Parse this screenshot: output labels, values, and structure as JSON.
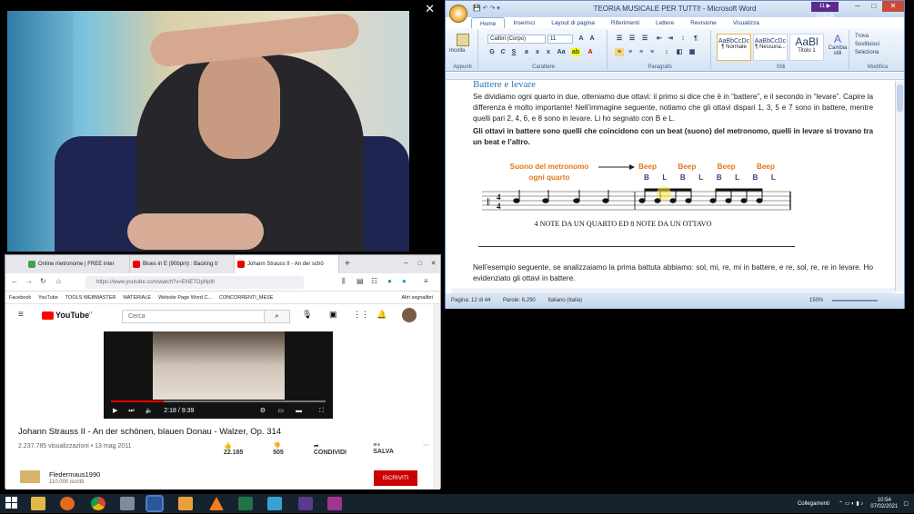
{
  "word": {
    "window_title": "TEORIA MUSICALE PER TUTTI! - Microsoft Word",
    "badge": "11 ▶ 0:03:28",
    "tabs": [
      "Home",
      "Inserisci",
      "Layout di pagina",
      "Riferimenti",
      "Lettere",
      "Revisione",
      "Visualizza"
    ],
    "font_name": "Calibri (Corpo)",
    "font_size": "11",
    "paste_label": "Incolla",
    "groups": {
      "clipboard": "Appunti",
      "font": "Carattere",
      "paragraph": "Paragrafo",
      "styles": "Stili",
      "editing": "Modifica"
    },
    "styles": [
      {
        "preview": "AaBbCcDc",
        "name": "¶ Normale"
      },
      {
        "preview": "AaBbCcDc",
        "name": "¶ Nessuna..."
      },
      {
        "preview": "AaBl",
        "name": "Titolo 1"
      }
    ],
    "change_styles": "Cambia stili",
    "editing": {
      "find": "Trova",
      "replace": "Sostituisci",
      "select": "Seleziona"
    },
    "heading": "Battere e levare",
    "para1": "Se dividiamo ogni quarto in due, otteniamo due ottavi: il primo si dice che è in “battere”, e il secondo in “levare”. Capire la differenza è molto importante! Nell’immagine seguente, notiamo che gli ottavi dispari 1, 3, 5 e 7 sono in battere, mentre quelli pari 2, 4, 6, e 8 sono in levare. Li ho segnato con B e L.",
    "para2": "Gli ottavi in battere sono quelli che coincidono con un beat (suono) del metronomo, quelli in levare si trovano tra un beat e l’altro.",
    "figure_label": "Suono del metronomo ogni quarto",
    "beeps": [
      "Beep",
      "Beep",
      "Beep",
      "Beep"
    ],
    "bl": [
      "B",
      "L",
      "B",
      "L",
      "B",
      "L",
      "B",
      "L"
    ],
    "caption": "4 NOTE DA UN QUARTO ED 8 NOTE DA UN OTTAVO",
    "para3": "Nell’esempio seguente, se analizzaiamo la prima battuta abbiamo: sol, mi, re, mi in battere, e re, sol, re, re in levare. Ho evidenziato gli ottavi in battere.",
    "status": {
      "page": "Pagina: 12 di 44",
      "words": "Parole: 6.290",
      "lang": "Italiano (Italia)",
      "zoom": "150%"
    }
  },
  "browser": {
    "tabs": [
      {
        "title": "Online metronome | FREE inter",
        "color": "#3fa34d"
      },
      {
        "title": "Blues in E (90bpm) : Backing tr",
        "color": "#e00"
      },
      {
        "title": "Johann Strauss II - An der schö",
        "color": "#e00"
      }
    ],
    "url": "https://www.youtube.com/watch?v=ENETOpNpIll",
    "bookmarks": [
      "Facebook",
      "YouTube",
      "TOOLS WEBMASTER",
      "MATERIALE",
      "Website Page Word C...",
      "CONCORRENTI_MESE",
      "Altri segnalibri"
    ],
    "youtube": {
      "logo": "YouTube",
      "logo_suffix": "IT",
      "search_placeholder": "Cerca",
      "video_time": "2:18 / 9:39",
      "video_title": "Johann Strauss II - An der schönen, blauen Donau - Walzer, Op. 314",
      "views": "2.237.785 visualizzazioni • 13 mag 2011",
      "likes": "22.185",
      "dislikes": "505",
      "share": "CONDIVIDI",
      "save": "SALVA",
      "channel": "Fledermaus1990",
      "subs": "110.000 iscritti",
      "subscribe": "ISCRIVITI"
    }
  },
  "taskbar": {
    "network_label": "Collegamenti",
    "time": "10:54",
    "date": "07/02/2021"
  }
}
